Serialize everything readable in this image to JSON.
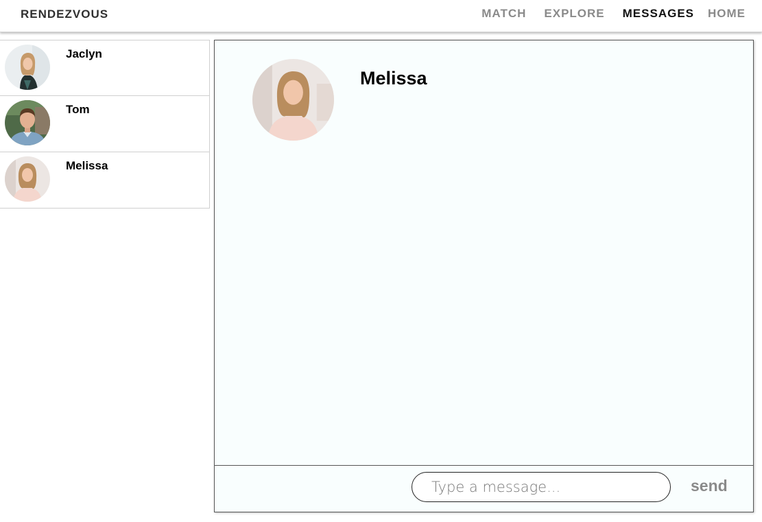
{
  "brand": "RENDEZVOUS",
  "nav": {
    "match": "MATCH",
    "explore": "EXPLORE",
    "messages": "MESSAGES",
    "home": "HOME"
  },
  "contacts": [
    {
      "name": "Jaclyn",
      "icon": "avatar-photo"
    },
    {
      "name": "Tom",
      "icon": "avatar-photo"
    },
    {
      "name": "Melissa",
      "icon": "avatar-photo"
    }
  ],
  "chat": {
    "name": "Melissa",
    "input_placeholder": "Type a message...",
    "send_label": "send"
  },
  "colors": {
    "nav_active": "#111111",
    "nav_inactive": "#8a8a8a",
    "chat_background": "#f9fefe"
  }
}
